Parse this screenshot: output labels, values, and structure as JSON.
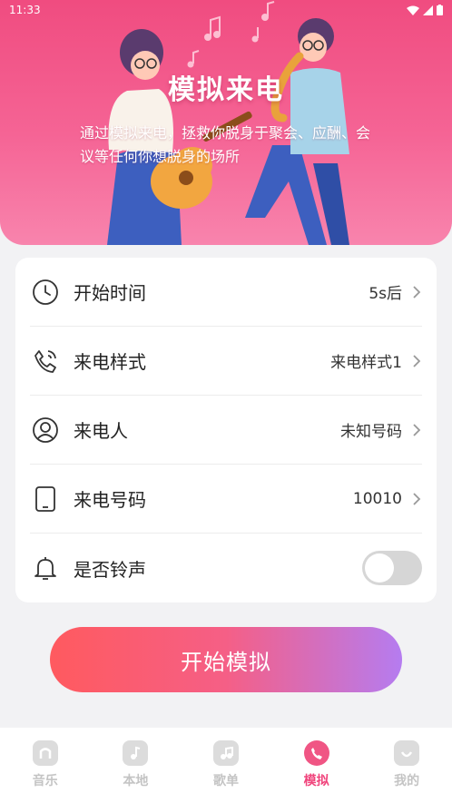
{
  "status_bar": {
    "time": "11:33"
  },
  "hero": {
    "title": "模拟来电",
    "description": "通过模拟来电，拯救你脱身于聚会、应酬、会议等任何你想脱身的场所"
  },
  "settings": {
    "start_time": {
      "label": "开始时间",
      "value": "5s后",
      "icon": "clock-icon"
    },
    "call_style": {
      "label": "来电样式",
      "value": "来电样式1",
      "icon": "phone-ring-icon"
    },
    "caller": {
      "label": "来电人",
      "value": "未知号码",
      "icon": "person-icon"
    },
    "caller_number": {
      "label": "来电号码",
      "value": "10010",
      "icon": "tablet-icon"
    },
    "ringtone": {
      "label": "是否铃声",
      "icon": "bell-icon",
      "enabled": false
    }
  },
  "start_button": {
    "label": "开始模拟"
  },
  "tabs": [
    {
      "label": "音乐",
      "icon": "music-icon"
    },
    {
      "label": "本地",
      "icon": "folder-music-icon"
    },
    {
      "label": "歌单",
      "icon": "playlist-icon"
    },
    {
      "label": "模拟",
      "icon": "phone-icon",
      "active": true
    },
    {
      "label": "我的",
      "icon": "profile-icon"
    }
  ],
  "colors": {
    "accent": "#f0447c",
    "hero_top": "#f04c80",
    "button_start": "#ff5a5f",
    "button_end": "#b57cf0"
  }
}
